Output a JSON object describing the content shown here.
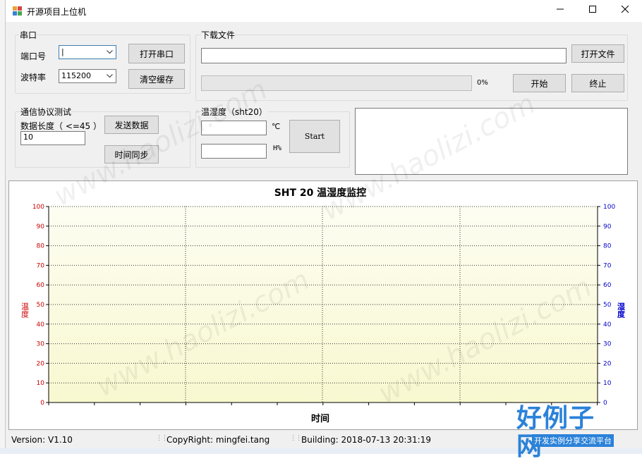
{
  "window": {
    "title": "开源项目上位机",
    "minimize_icon": "minimize-icon",
    "maximize_icon": "maximize-icon",
    "close_icon": "close-icon"
  },
  "serial": {
    "group_label": "串口",
    "port_label": "端口号",
    "port_value": "|",
    "baud_label": "波特率",
    "baud_value": "115200",
    "open_button": "打开串口",
    "clear_button": "清空缓存"
  },
  "download": {
    "group_label": "下载文件",
    "file_path": "",
    "open_file_button": "打开文件",
    "progress_percent": 0,
    "progress_text": "0%",
    "start_button": "开始",
    "stop_button": "终止"
  },
  "protocol": {
    "group_label": "通信协议测试",
    "length_label": "数据长度（  <=45  ）",
    "length_value": "10",
    "send_button": "发送数据",
    "sync_button": "时间同步"
  },
  "sensor": {
    "group_label": "温湿度（sht20）",
    "temp_value": "",
    "temp_unit": "℃",
    "humidity_value": "",
    "humidity_unit": "H%",
    "start_button": "Start"
  },
  "chart_data": {
    "type": "line",
    "title": "SHT 20 温湿度监控",
    "xlabel": "时间",
    "ylabel_left": "温度",
    "ylabel_right": "湿度",
    "ylim": [
      0,
      100
    ],
    "y_ticks": [
      "0",
      "10",
      "20",
      "30",
      "40",
      "50",
      "60",
      "70",
      "80",
      "90",
      "100"
    ],
    "series": [],
    "colors": {
      "left_axis": "#cc0000",
      "right_axis": "#0000cc",
      "plot_bg": "#fbfbe6"
    }
  },
  "status_bar": {
    "version": "Version: V1.10",
    "copyright": "CopyRight: mingfei.tang",
    "building": "Building: 2018-07-13 20:31:19"
  },
  "watermark": {
    "url": "www.haolizi.com",
    "brand": "好例子网",
    "slogan": "开发实例分享交流平台"
  }
}
